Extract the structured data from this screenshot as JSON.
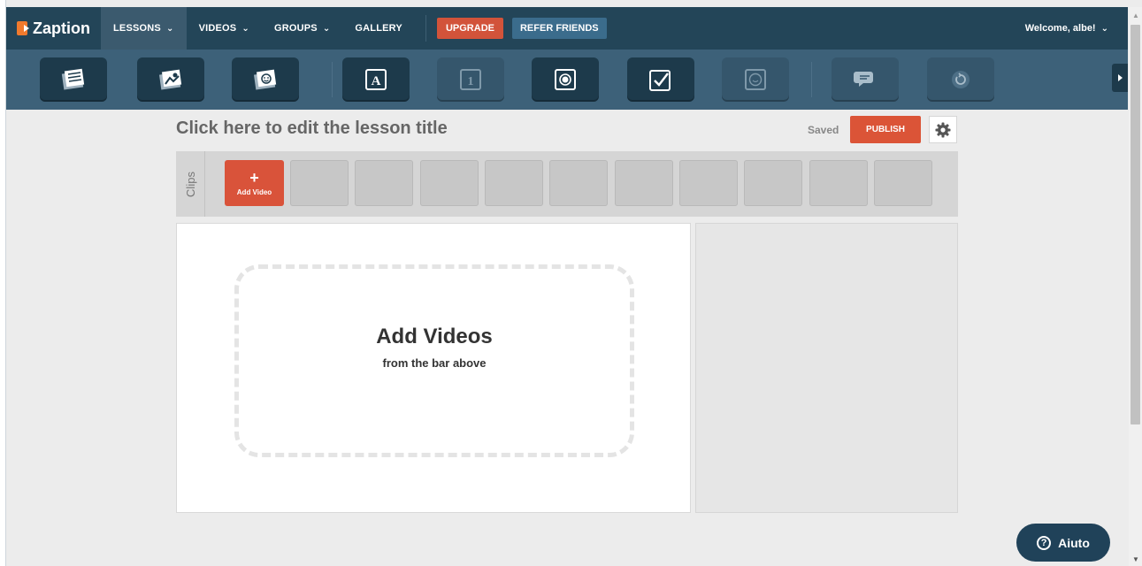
{
  "brand": {
    "name": "Zaption"
  },
  "nav": {
    "items": [
      {
        "label": "LESSONS",
        "dropdown": true,
        "active": true
      },
      {
        "label": "VIDEOS",
        "dropdown": true
      },
      {
        "label": "GROUPS",
        "dropdown": true
      },
      {
        "label": "GALLERY",
        "dropdown": false
      }
    ],
    "upgrade_label": "UPGRADE",
    "refer_label": "REFER FRIENDS",
    "welcome_label": "Welcome, albe!"
  },
  "toolbar": {
    "tools": [
      {
        "icon": "text-block-icon",
        "enabled": true
      },
      {
        "icon": "image-icon",
        "enabled": true
      },
      {
        "icon": "drawing-icon",
        "enabled": true
      },
      {
        "icon": "open-response-icon",
        "enabled": true,
        "glyph": "A"
      },
      {
        "icon": "numeric-response-icon",
        "enabled": false,
        "glyph": "1"
      },
      {
        "icon": "multiple-choice-icon",
        "enabled": true
      },
      {
        "icon": "checkbox-icon",
        "enabled": true
      },
      {
        "icon": "emoji-poll-icon",
        "enabled": false
      },
      {
        "icon": "discussion-icon",
        "enabled": false
      },
      {
        "icon": "jump-icon",
        "enabled": false
      }
    ]
  },
  "lesson": {
    "title": "Click here to edit the lesson title",
    "status": "Saved",
    "publish_label": "PUBLISH"
  },
  "clips": {
    "label": "Clips",
    "add_label": "Add Video",
    "empty_slots": 10
  },
  "dropzone": {
    "title": "Add Videos",
    "subtitle": "from the bar above"
  },
  "help": {
    "label": "Aiuto"
  },
  "colors": {
    "nav_bg": "#234558",
    "toolbar_bg": "#3d6179",
    "accent": "#db5437",
    "refer": "#3b6c8c"
  }
}
